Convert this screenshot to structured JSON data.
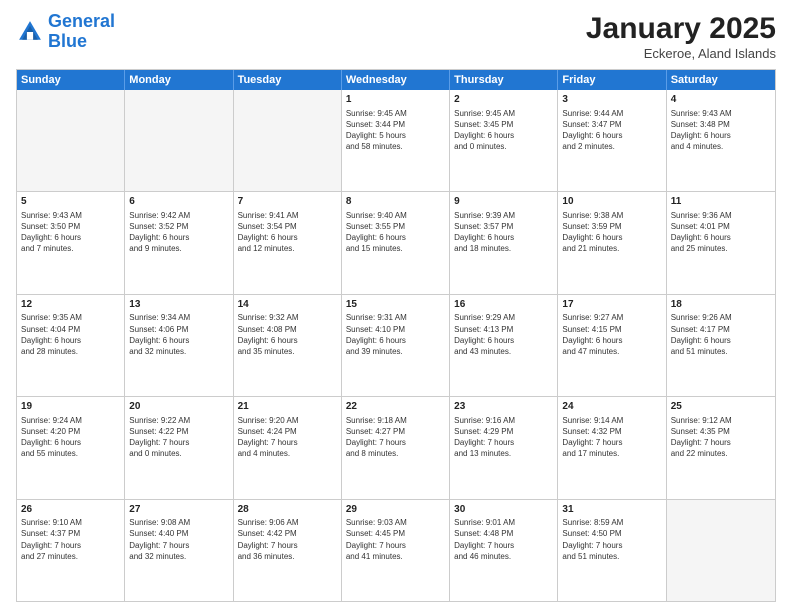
{
  "logo": {
    "line1": "General",
    "line2": "Blue"
  },
  "title": "January 2025",
  "location": "Eckeroe, Aland Islands",
  "weekdays": [
    "Sunday",
    "Monday",
    "Tuesday",
    "Wednesday",
    "Thursday",
    "Friday",
    "Saturday"
  ],
  "rows": [
    [
      {
        "day": "",
        "text": "",
        "empty": true
      },
      {
        "day": "",
        "text": "",
        "empty": true
      },
      {
        "day": "",
        "text": "",
        "empty": true
      },
      {
        "day": "1",
        "text": "Sunrise: 9:45 AM\nSunset: 3:44 PM\nDaylight: 5 hours\nand 58 minutes.",
        "empty": false
      },
      {
        "day": "2",
        "text": "Sunrise: 9:45 AM\nSunset: 3:45 PM\nDaylight: 6 hours\nand 0 minutes.",
        "empty": false
      },
      {
        "day": "3",
        "text": "Sunrise: 9:44 AM\nSunset: 3:47 PM\nDaylight: 6 hours\nand 2 minutes.",
        "empty": false
      },
      {
        "day": "4",
        "text": "Sunrise: 9:43 AM\nSunset: 3:48 PM\nDaylight: 6 hours\nand 4 minutes.",
        "empty": false
      }
    ],
    [
      {
        "day": "5",
        "text": "Sunrise: 9:43 AM\nSunset: 3:50 PM\nDaylight: 6 hours\nand 7 minutes.",
        "empty": false
      },
      {
        "day": "6",
        "text": "Sunrise: 9:42 AM\nSunset: 3:52 PM\nDaylight: 6 hours\nand 9 minutes.",
        "empty": false
      },
      {
        "day": "7",
        "text": "Sunrise: 9:41 AM\nSunset: 3:54 PM\nDaylight: 6 hours\nand 12 minutes.",
        "empty": false
      },
      {
        "day": "8",
        "text": "Sunrise: 9:40 AM\nSunset: 3:55 PM\nDaylight: 6 hours\nand 15 minutes.",
        "empty": false
      },
      {
        "day": "9",
        "text": "Sunrise: 9:39 AM\nSunset: 3:57 PM\nDaylight: 6 hours\nand 18 minutes.",
        "empty": false
      },
      {
        "day": "10",
        "text": "Sunrise: 9:38 AM\nSunset: 3:59 PM\nDaylight: 6 hours\nand 21 minutes.",
        "empty": false
      },
      {
        "day": "11",
        "text": "Sunrise: 9:36 AM\nSunset: 4:01 PM\nDaylight: 6 hours\nand 25 minutes.",
        "empty": false
      }
    ],
    [
      {
        "day": "12",
        "text": "Sunrise: 9:35 AM\nSunset: 4:04 PM\nDaylight: 6 hours\nand 28 minutes.",
        "empty": false
      },
      {
        "day": "13",
        "text": "Sunrise: 9:34 AM\nSunset: 4:06 PM\nDaylight: 6 hours\nand 32 minutes.",
        "empty": false
      },
      {
        "day": "14",
        "text": "Sunrise: 9:32 AM\nSunset: 4:08 PM\nDaylight: 6 hours\nand 35 minutes.",
        "empty": false
      },
      {
        "day": "15",
        "text": "Sunrise: 9:31 AM\nSunset: 4:10 PM\nDaylight: 6 hours\nand 39 minutes.",
        "empty": false
      },
      {
        "day": "16",
        "text": "Sunrise: 9:29 AM\nSunset: 4:13 PM\nDaylight: 6 hours\nand 43 minutes.",
        "empty": false
      },
      {
        "day": "17",
        "text": "Sunrise: 9:27 AM\nSunset: 4:15 PM\nDaylight: 6 hours\nand 47 minutes.",
        "empty": false
      },
      {
        "day": "18",
        "text": "Sunrise: 9:26 AM\nSunset: 4:17 PM\nDaylight: 6 hours\nand 51 minutes.",
        "empty": false
      }
    ],
    [
      {
        "day": "19",
        "text": "Sunrise: 9:24 AM\nSunset: 4:20 PM\nDaylight: 6 hours\nand 55 minutes.",
        "empty": false
      },
      {
        "day": "20",
        "text": "Sunrise: 9:22 AM\nSunset: 4:22 PM\nDaylight: 7 hours\nand 0 minutes.",
        "empty": false
      },
      {
        "day": "21",
        "text": "Sunrise: 9:20 AM\nSunset: 4:24 PM\nDaylight: 7 hours\nand 4 minutes.",
        "empty": false
      },
      {
        "day": "22",
        "text": "Sunrise: 9:18 AM\nSunset: 4:27 PM\nDaylight: 7 hours\nand 8 minutes.",
        "empty": false
      },
      {
        "day": "23",
        "text": "Sunrise: 9:16 AM\nSunset: 4:29 PM\nDaylight: 7 hours\nand 13 minutes.",
        "empty": false
      },
      {
        "day": "24",
        "text": "Sunrise: 9:14 AM\nSunset: 4:32 PM\nDaylight: 7 hours\nand 17 minutes.",
        "empty": false
      },
      {
        "day": "25",
        "text": "Sunrise: 9:12 AM\nSunset: 4:35 PM\nDaylight: 7 hours\nand 22 minutes.",
        "empty": false
      }
    ],
    [
      {
        "day": "26",
        "text": "Sunrise: 9:10 AM\nSunset: 4:37 PM\nDaylight: 7 hours\nand 27 minutes.",
        "empty": false
      },
      {
        "day": "27",
        "text": "Sunrise: 9:08 AM\nSunset: 4:40 PM\nDaylight: 7 hours\nand 32 minutes.",
        "empty": false
      },
      {
        "day": "28",
        "text": "Sunrise: 9:06 AM\nSunset: 4:42 PM\nDaylight: 7 hours\nand 36 minutes.",
        "empty": false
      },
      {
        "day": "29",
        "text": "Sunrise: 9:03 AM\nSunset: 4:45 PM\nDaylight: 7 hours\nand 41 minutes.",
        "empty": false
      },
      {
        "day": "30",
        "text": "Sunrise: 9:01 AM\nSunset: 4:48 PM\nDaylight: 7 hours\nand 46 minutes.",
        "empty": false
      },
      {
        "day": "31",
        "text": "Sunrise: 8:59 AM\nSunset: 4:50 PM\nDaylight: 7 hours\nand 51 minutes.",
        "empty": false
      },
      {
        "day": "",
        "text": "",
        "empty": true
      }
    ]
  ]
}
